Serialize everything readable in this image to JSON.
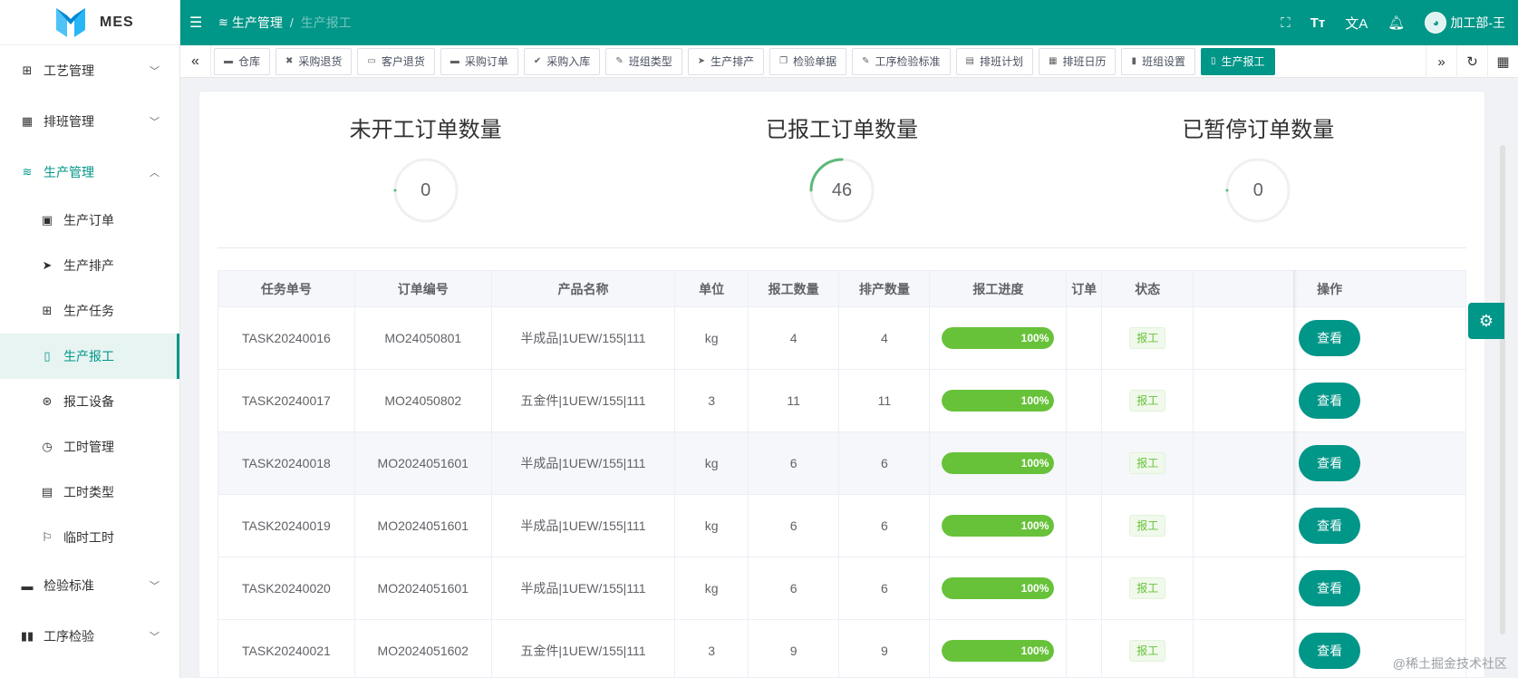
{
  "app": {
    "name": "MES"
  },
  "header": {
    "breadcrumb": [
      "生产管理",
      "生产报工"
    ],
    "user": "加工部-王"
  },
  "sidebar": {
    "items": [
      {
        "label": "工艺管理",
        "icon": "gift-icon"
      },
      {
        "label": "排班管理",
        "icon": "calendar-icon"
      },
      {
        "label": "生产管理",
        "icon": "database-icon"
      }
    ],
    "sub_items": [
      {
        "label": "生产订单",
        "icon": "clipboard-icon"
      },
      {
        "label": "生产排产",
        "icon": "send-icon"
      },
      {
        "label": "生产任务",
        "icon": "gift-icon"
      },
      {
        "label": "生产报工",
        "icon": "mobile-icon"
      },
      {
        "label": "报工设备",
        "icon": "aperture-icon"
      },
      {
        "label": "工时管理",
        "icon": "clock-icon"
      },
      {
        "label": "工时类型",
        "icon": "document-icon"
      },
      {
        "label": "临时工时",
        "icon": "flag-icon"
      }
    ],
    "bottom_items": [
      {
        "label": "检验标准",
        "icon": "monitor-icon"
      },
      {
        "label": "工序检验",
        "icon": "book-icon"
      }
    ]
  },
  "tabs": [
    {
      "label": "仓库",
      "icon": "briefcase-icon"
    },
    {
      "label": "采购退货",
      "icon": "ticket-icon"
    },
    {
      "label": "客户退货",
      "icon": "inbox-icon"
    },
    {
      "label": "采购订单",
      "icon": "briefcase-icon"
    },
    {
      "label": "采购入库",
      "icon": "check-icon"
    },
    {
      "label": "班组类型",
      "icon": "edit-icon"
    },
    {
      "label": "生产排产",
      "icon": "send-icon"
    },
    {
      "label": "检验单据",
      "icon": "copy-icon"
    },
    {
      "label": "工序检验标准",
      "icon": "edit-icon"
    },
    {
      "label": "排班计划",
      "icon": "chat-icon"
    },
    {
      "label": "排班日历",
      "icon": "calendar-icon"
    },
    {
      "label": "班组设置",
      "icon": "notebook-icon"
    },
    {
      "label": "生产报工",
      "icon": "mobile-icon"
    }
  ],
  "stats": [
    {
      "title": "未开工订单数量",
      "value": "0",
      "fraction": 0
    },
    {
      "title": "已报工订单数量",
      "value": "46",
      "fraction": 0.25
    },
    {
      "title": "已暂停订单数量",
      "value": "0",
      "fraction": 0
    }
  ],
  "table": {
    "columns": [
      "任务单号",
      "订单编号",
      "产品名称",
      "单位",
      "报工数量",
      "排产数量",
      "报工进度",
      "订单",
      "状态",
      "操作"
    ],
    "rows": [
      {
        "task": "TASK20240016",
        "order": "MO24050801",
        "product": "半成品|1UEW/155|111",
        "unit": "kg",
        "reported": "4",
        "scheduled": "4",
        "progress": "100%",
        "progress_fraction": 1,
        "status": "报工",
        "action": "查看"
      },
      {
        "task": "TASK20240017",
        "order": "MO24050802",
        "product": "五金件|1UEW/155|111",
        "unit": "3",
        "reported": "11",
        "scheduled": "11",
        "progress": "100%",
        "progress_fraction": 1,
        "status": "报工",
        "action": "查看"
      },
      {
        "task": "TASK20240018",
        "order": "MO2024051601",
        "product": "半成品|1UEW/155|111",
        "unit": "kg",
        "reported": "6",
        "scheduled": "6",
        "progress": "100%",
        "progress_fraction": 1,
        "status": "报工",
        "action": "查看"
      },
      {
        "task": "TASK20240019",
        "order": "MO2024051601",
        "product": "半成品|1UEW/155|111",
        "unit": "kg",
        "reported": "6",
        "scheduled": "6",
        "progress": "100%",
        "progress_fraction": 1,
        "status": "报工",
        "action": "查看"
      },
      {
        "task": "TASK20240020",
        "order": "MO2024051601",
        "product": "半成品|1UEW/155|111",
        "unit": "kg",
        "reported": "6",
        "scheduled": "6",
        "progress": "100%",
        "progress_fraction": 1,
        "status": "报工",
        "action": "查看"
      },
      {
        "task": "TASK20240021",
        "order": "MO2024051602",
        "product": "五金件|1UEW/155|111",
        "unit": "3",
        "reported": "9",
        "scheduled": "9",
        "progress": "100%",
        "progress_fraction": 1,
        "status": "报工",
        "action": "查看"
      }
    ]
  },
  "watermark": "@稀土掘金技术社区",
  "colors": {
    "primary": "#009688",
    "success": "#67c23a"
  }
}
